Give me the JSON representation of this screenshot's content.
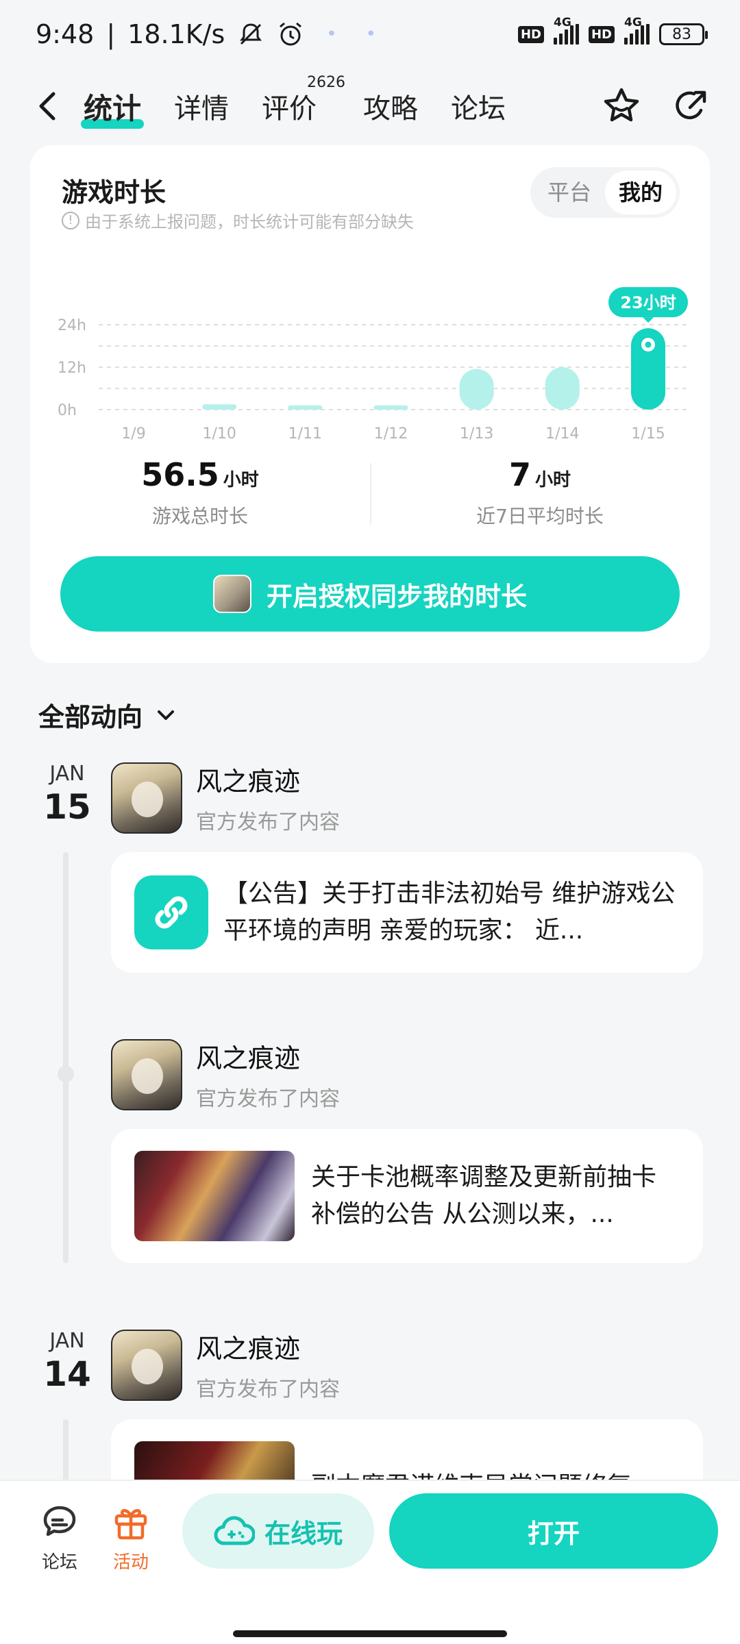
{
  "status_bar": {
    "time": "9:48",
    "speed": "18.1K/s",
    "net1_type": "4G",
    "net2_type": "4G",
    "hd1": "HD",
    "hd2": "HD",
    "battery": "83"
  },
  "nav": {
    "tabs": [
      {
        "label": "统计",
        "active": true
      },
      {
        "label": "详情"
      },
      {
        "label": "评价",
        "badge": "2626"
      },
      {
        "label": "攻略"
      },
      {
        "label": "论坛"
      }
    ]
  },
  "stats_card": {
    "title": "游戏时长",
    "note": "由于系统上报问题，时长统计可能有部分缺失",
    "segment": {
      "platform": "平台",
      "mine": "我的",
      "selected": "我的"
    },
    "total": {
      "value": "56.5",
      "unit": "小时",
      "label": "游戏总时长"
    },
    "average": {
      "value": "7",
      "unit": "小时",
      "label": "近7日平均时长"
    },
    "sync_button": "开启授权同步我的时长"
  },
  "chart_data": {
    "type": "bar",
    "categories": [
      "1/9",
      "1/10",
      "1/11",
      "1/12",
      "1/13",
      "1/14",
      "1/15"
    ],
    "values": [
      0,
      1.5,
      1.2,
      1.2,
      11.5,
      12,
      23
    ],
    "ylabel": "",
    "ylim": [
      0,
      24
    ],
    "y_ticks": [
      "0h",
      "12h",
      "24h"
    ],
    "highlight": {
      "index": 6,
      "label": "23小时"
    },
    "grid": true,
    "colors": {
      "bar": "#b4f1ea",
      "highlight": "#15d4c0"
    }
  },
  "feed": {
    "filter": "全部动向",
    "groups": [
      {
        "month": "JAN",
        "day": "15",
        "items": [
          {
            "name": "风之痕迹",
            "sub": "官方发布了内容",
            "text": "【公告】关于打击非法初始号 维护游戏公平环境的声明 亲爱的玩家： 近..."
          },
          {
            "name": "风之痕迹",
            "sub": "官方发布了内容",
            "text": "关于卡池概率调整及更新前抽卡补偿的公告 从公测以来，..."
          }
        ]
      },
      {
        "month": "JAN",
        "day": "14",
        "items": [
          {
            "name": "风之痕迹",
            "sub": "官方发布了内容",
            "text": "副本魔君诺维克异常问题修复"
          }
        ]
      }
    ]
  },
  "bottom": {
    "forum": "论坛",
    "activity": "活动",
    "online": "在线玩",
    "open": "打开"
  },
  "colors": {
    "accent": "#15d4c0",
    "accent_light": "#b4f1ea",
    "activity": "#f26b2a"
  }
}
